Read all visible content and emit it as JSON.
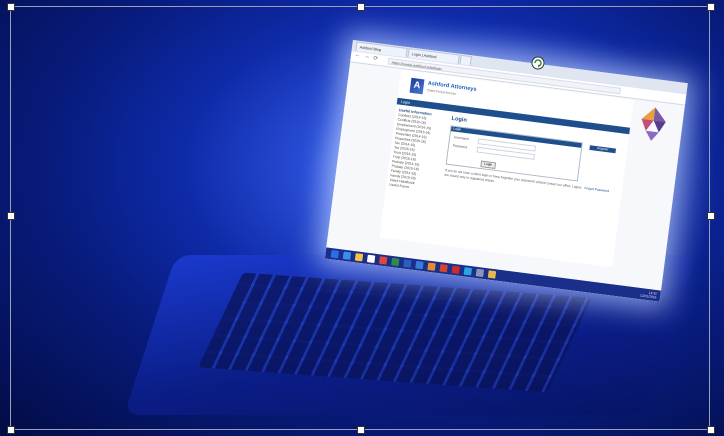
{
  "browser": {
    "tabs": [
      "Ashford Blog",
      "Login | Ashford",
      ""
    ],
    "url": "https://portal.ashford.edu/login",
    "nav_symbols": [
      "←",
      "→",
      "⟳"
    ]
  },
  "site": {
    "logo_letters": "A",
    "brand": "Ashford Attorneys",
    "tagline": "Client Portal Access",
    "nav_bar_label": "Login"
  },
  "sidebar": {
    "heading": "Useful Information",
    "items": [
      "Conflicts (2014-15)",
      "Conflicts (2015-16)",
      "Employment (2014-15)",
      "Employment (2015-16)",
      "Properties (2014-15)",
      "Properties (2015-16)",
      "Tax (2014-15)",
      "Tax (2015-16)",
      "Trust (2014-15)",
      "Trust (2015-16)",
      "Probate (2014-15)",
      "Probate (2015-16)",
      "Family (2014-15)",
      "Family (2015-16)",
      "Client Handbook",
      "Useful Forms"
    ]
  },
  "login": {
    "title": "Login",
    "panel_header": "Login",
    "username_label": "Username",
    "password_label": "Password",
    "button_label": "Login",
    "signup_label": "Register",
    "forgot_label": "Forgot Password",
    "notice": "If you do not have a client login or have forgotten your password, please contact our office. Logins are issued only to registered clients."
  },
  "taskbar": {
    "time": "14:32",
    "date": "12/01/2016",
    "icons": [
      {
        "name": "start-icon",
        "color": "#2b6fe6"
      },
      {
        "name": "search-icon",
        "color": "#3a8ef0"
      },
      {
        "name": "file-explorer-icon",
        "color": "#f2c443"
      },
      {
        "name": "store-icon",
        "color": "#ffffff"
      },
      {
        "name": "chrome-icon",
        "color": "#e0463b"
      },
      {
        "name": "excel-icon",
        "color": "#2e8b4a"
      },
      {
        "name": "word-icon",
        "color": "#2d5fbe"
      },
      {
        "name": "outlook-icon",
        "color": "#3a7ad8"
      },
      {
        "name": "media-icon",
        "color": "#e88a2f"
      },
      {
        "name": "powerpoint-icon",
        "color": "#d2462f"
      },
      {
        "name": "acrobat-icon",
        "color": "#c92c2c"
      },
      {
        "name": "skype-icon",
        "color": "#2aa5e0"
      },
      {
        "name": "settings-icon",
        "color": "#8c95b4"
      },
      {
        "name": "folder-icon",
        "color": "#e7b84b"
      }
    ]
  }
}
